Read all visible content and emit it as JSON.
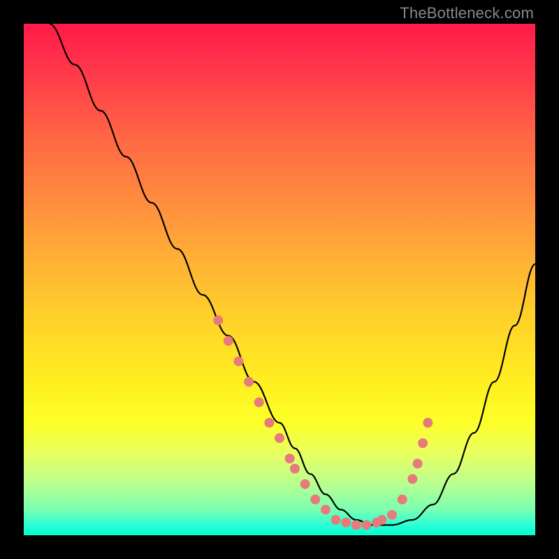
{
  "watermark": "TheBottleneck.com",
  "chart_data": {
    "type": "line",
    "title": "",
    "xlabel": "",
    "ylabel": "",
    "xlim": [
      0,
      100
    ],
    "ylim": [
      0,
      100
    ],
    "series": [
      {
        "name": "bottleneck-curve",
        "x": [
          5,
          10,
          15,
          20,
          25,
          30,
          35,
          40,
          45,
          50,
          53,
          56,
          59,
          62,
          65,
          68,
          72,
          76,
          80,
          84,
          88,
          92,
          96,
          100
        ],
        "y": [
          100,
          92,
          83,
          74,
          65,
          56,
          47,
          39,
          30,
          22,
          17,
          12,
          8,
          5,
          3,
          2,
          2,
          3,
          6,
          12,
          20,
          30,
          41,
          53
        ]
      }
    ],
    "highlight_points": {
      "name": "sample-dots",
      "x": [
        38,
        40,
        42,
        44,
        46,
        48,
        50,
        52,
        53,
        55,
        57,
        59,
        61,
        63,
        65,
        67,
        69,
        70,
        72,
        74,
        76,
        77,
        78,
        79
      ],
      "y": [
        42,
        38,
        34,
        30,
        26,
        22,
        19,
        15,
        13,
        10,
        7,
        5,
        3,
        2.5,
        2,
        2,
        2.5,
        3,
        4,
        7,
        11,
        14,
        18,
        22
      ]
    },
    "background_gradient": {
      "top": "#ff1a4a",
      "mid": "#ffee20",
      "bottom": "#00ffcc"
    }
  }
}
